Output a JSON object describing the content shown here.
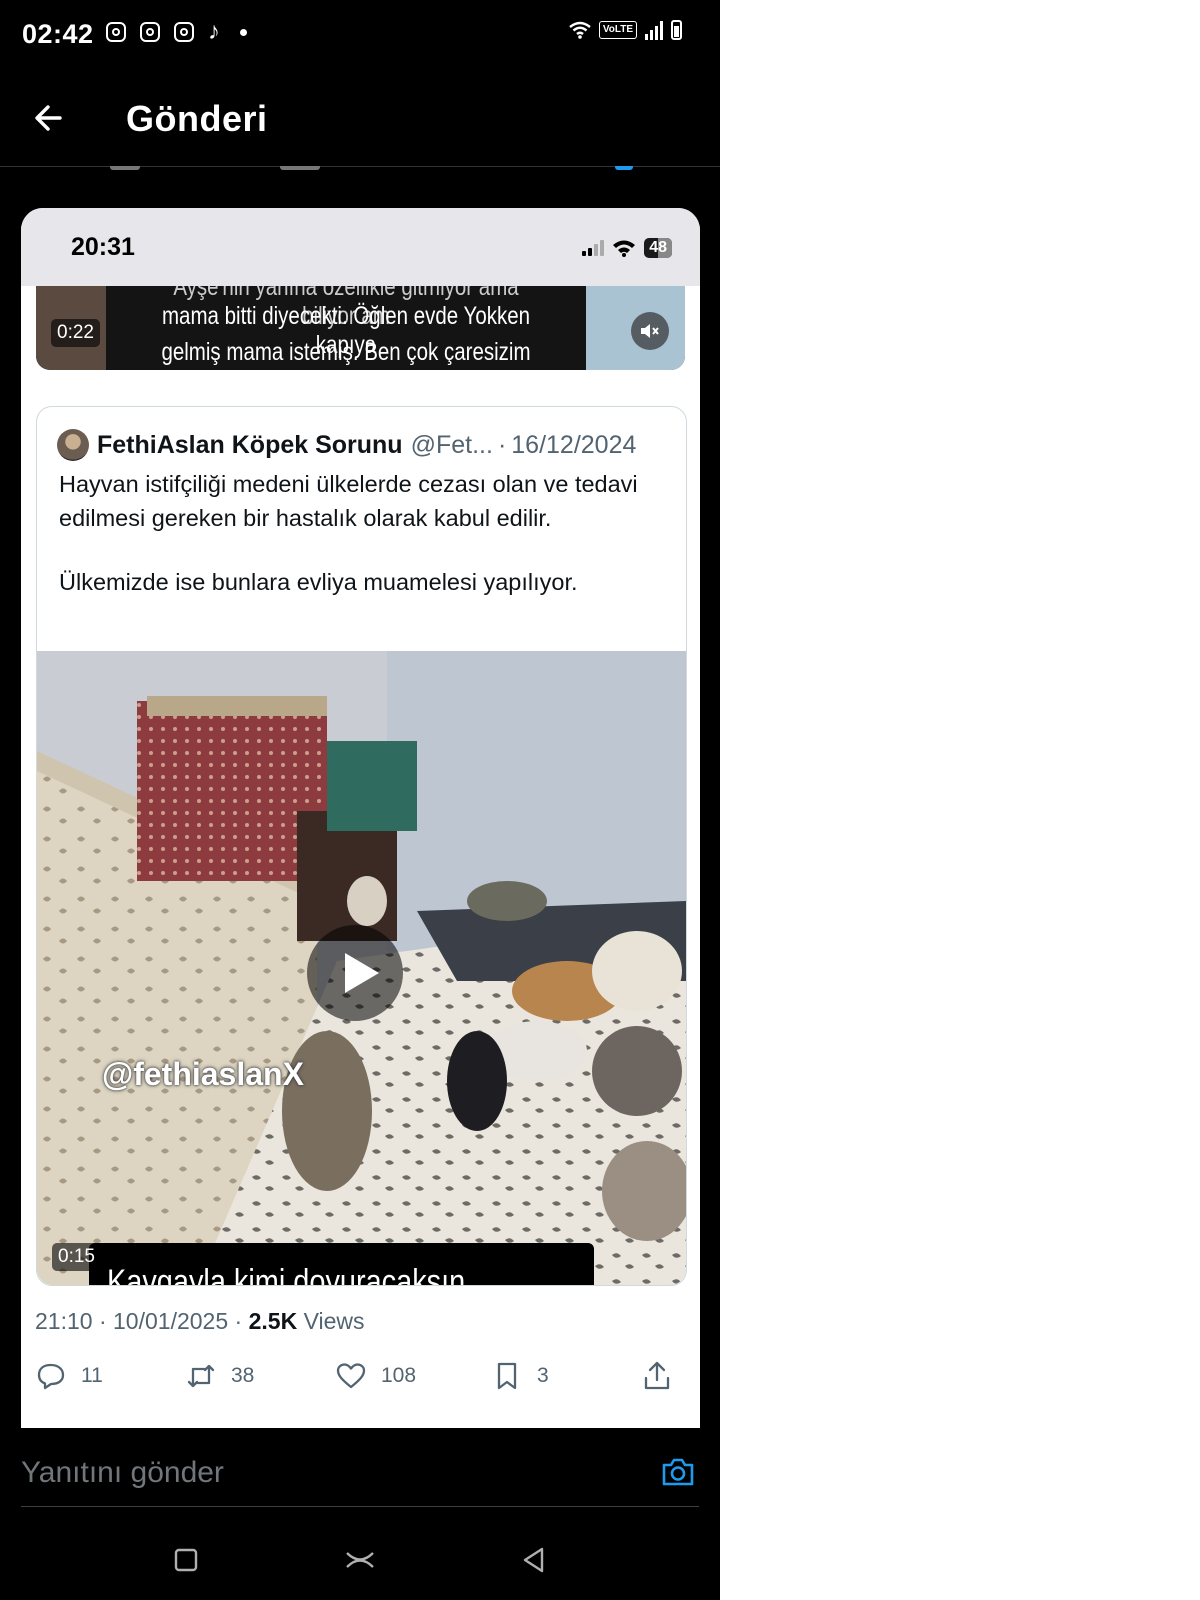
{
  "status_bar": {
    "time": "02:42",
    "notification_icons": [
      "instagram-icon",
      "instagram-icon",
      "instagram-icon",
      "tiktok-icon",
      "more-dot-icon"
    ],
    "volte_label": "VoLTE",
    "icons": [
      "wifi-icon",
      "signal-icon",
      "battery-icon"
    ]
  },
  "header": {
    "back_icon": "arrow-left-icon",
    "title": "Gönderi"
  },
  "embedded_screenshot": {
    "ios_time": "20:31",
    "ios_battery": "48",
    "top_video": {
      "subtitle_line_0": "Ayşe'nin yanına özellikle gitmiyor ama biliyor am",
      "subtitle_line_1": "mama bitti diyecekti. Öğlen evde Yokken kapıya",
      "subtitle_line_2": "gelmiş mama istemiş.  Ben çok çaresizim ne",
      "duration": "0:22",
      "mute_icon": "volume-muted-icon"
    },
    "quote": {
      "author_name": "FethiAslan Köpek Sorunu",
      "handle": "@Fet...",
      "separator": "·",
      "date": "16/12/2024",
      "body_1": "Hayvan istifçiliği medeni ülkelerde cezası olan ve tedavi edilmesi gereken bir hastalık olarak kabul edilir.",
      "body_2": "Ülkemizde ise bunlara evliya muamelesi yapılıyor.",
      "video": {
        "watermark": "@fethiaslanX",
        "duration": "0:15",
        "caption": "Kavgayla kimi doyuracaksın",
        "play_icon": "play-icon"
      }
    },
    "meta": {
      "time": "21:10",
      "sep": "·",
      "date": "10/01/2025",
      "views_count": "2.5K",
      "views_label": "Views"
    },
    "actions": {
      "replies": "11",
      "reposts": "38",
      "likes": "108",
      "bookmarks": "3"
    }
  },
  "reply_bar": {
    "placeholder": "Yanıtını gönder",
    "camera_icon": "camera-icon"
  },
  "colors": {
    "x_blue": "#1d9bf0",
    "dark_bg": "#000000",
    "muted_text": "#536471"
  }
}
